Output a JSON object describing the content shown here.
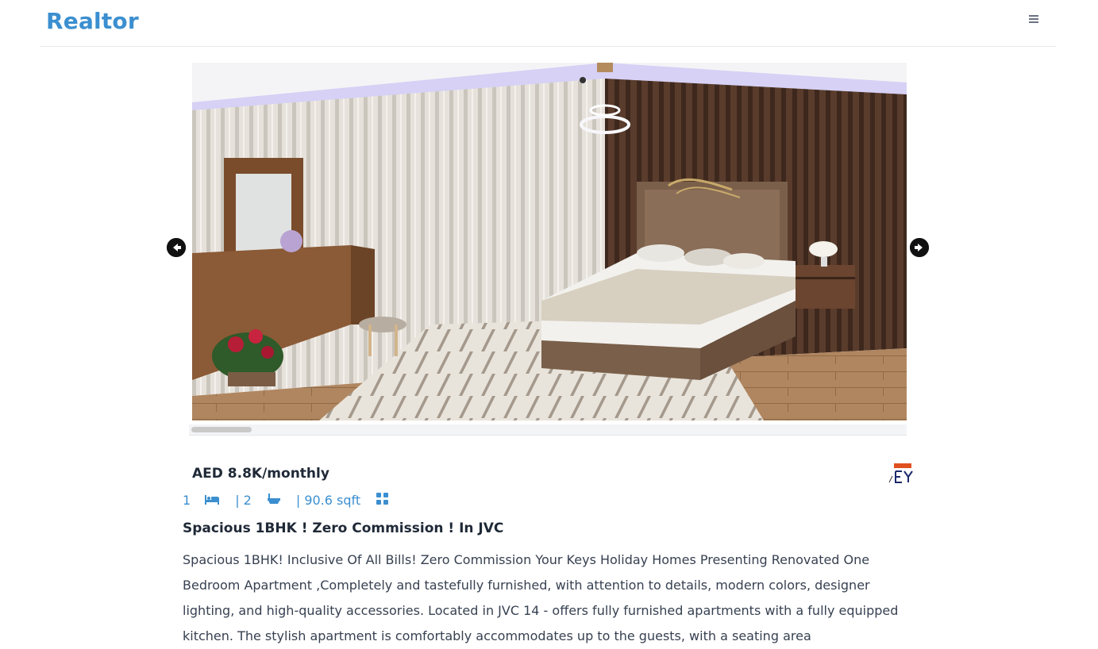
{
  "navbar": {
    "brand": "Realtor",
    "menu_icon": "hamburger-icon"
  },
  "carousel": {
    "prev_icon": "arrow-left-circle-icon",
    "next_icon": "arrow-right-circle-icon"
  },
  "listing": {
    "price": "AED 8.8K/monthly",
    "specs": {
      "rooms": "1",
      "baths": "| 2",
      "area": "| 90.6 sqft"
    },
    "title": "Spacious 1BHK ! Zero Commission ! In JVC",
    "description": "Spacious 1BHK! Inclusive Of All Bills! Zero Commission Your Keys Holiday Homes Presenting Renovated One Bedroom Apartment ,Completely and tastefully furnished, with attention to details, modern colors, designer lighting, and high-quality accessories. Located in JVC 14 - offers fully furnished apartments with a fully equipped kitchen. The stylish apartment is comfortably accommodates up to the guests, with a seating area"
  },
  "colors": {
    "brand": "#3b8fd0",
    "text": "#1f2937"
  }
}
